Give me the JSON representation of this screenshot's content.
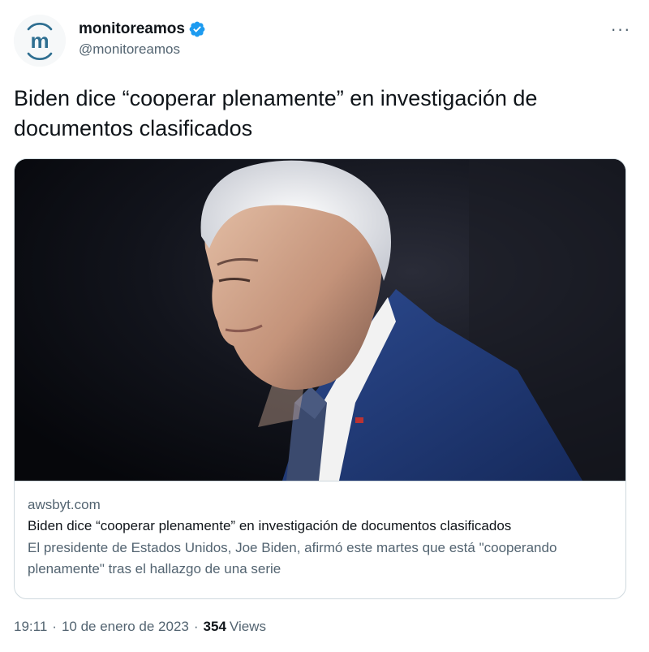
{
  "account": {
    "display_name": "monitoreamos",
    "handle": "@monitoreamos",
    "avatar_letter": "m",
    "avatar_icon": "monitoreamos-logo-icon",
    "verified_icon": "verified-badge-icon",
    "verified_color": "#1d9bf0"
  },
  "more_button": {
    "label": "···",
    "icon": "more-horizontal-icon"
  },
  "tweet": {
    "text": "Biden dice “cooperar plenamente” en investigación de documentos clasificados"
  },
  "card": {
    "domain": "awsbyt.com",
    "title": "Biden dice “cooperar plenamente” en investigación de documentos clasificados",
    "description": "El presidente de Estados Unidos, Joe Biden, afirmó este martes que está \"cooperando plenamente\" tras el hallazgo de una serie",
    "image": "photo of Joe Biden in a navy suit against a dark background"
  },
  "meta": {
    "time": "19:11",
    "separator": "·",
    "date": "10 de enero de 2023",
    "views_count": "354",
    "views_label": "Views"
  },
  "colors": {
    "text_primary": "#0f1419",
    "text_secondary": "#536471",
    "border": "#cfd9de",
    "brand_teal": "#2f6f91",
    "link_blue": "#1d9bf0"
  }
}
